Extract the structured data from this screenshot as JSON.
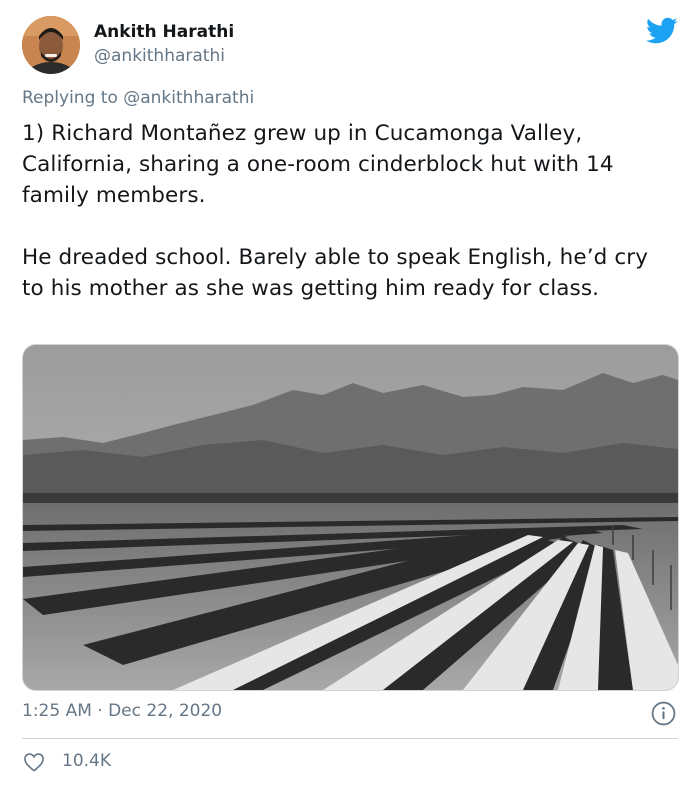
{
  "author": {
    "name": "Ankith Harathi",
    "handle": "@ankithharathi"
  },
  "reply": {
    "text": "Replying to @ankithharathi"
  },
  "tweet": {
    "paragraph_1": "1) Richard Montañez grew up in Cucamonga Valley, California, sharing a one-room cinderblock hut with 14 family members.",
    "paragraph_2": "He dreaded school. Barely able to speak English, he’d cry to his mother as she was getting him ready for class."
  },
  "media": {
    "icon": "black-and-white-photo-of-mountains-and-crop-field"
  },
  "meta": {
    "timestamp": "1:25 AM · Dec 22, 2020"
  },
  "stats": {
    "likes": "10.4K"
  },
  "colors": {
    "brand": "#1da1f2",
    "secondary_text": "#657786",
    "divider": "#ccd6dd"
  }
}
